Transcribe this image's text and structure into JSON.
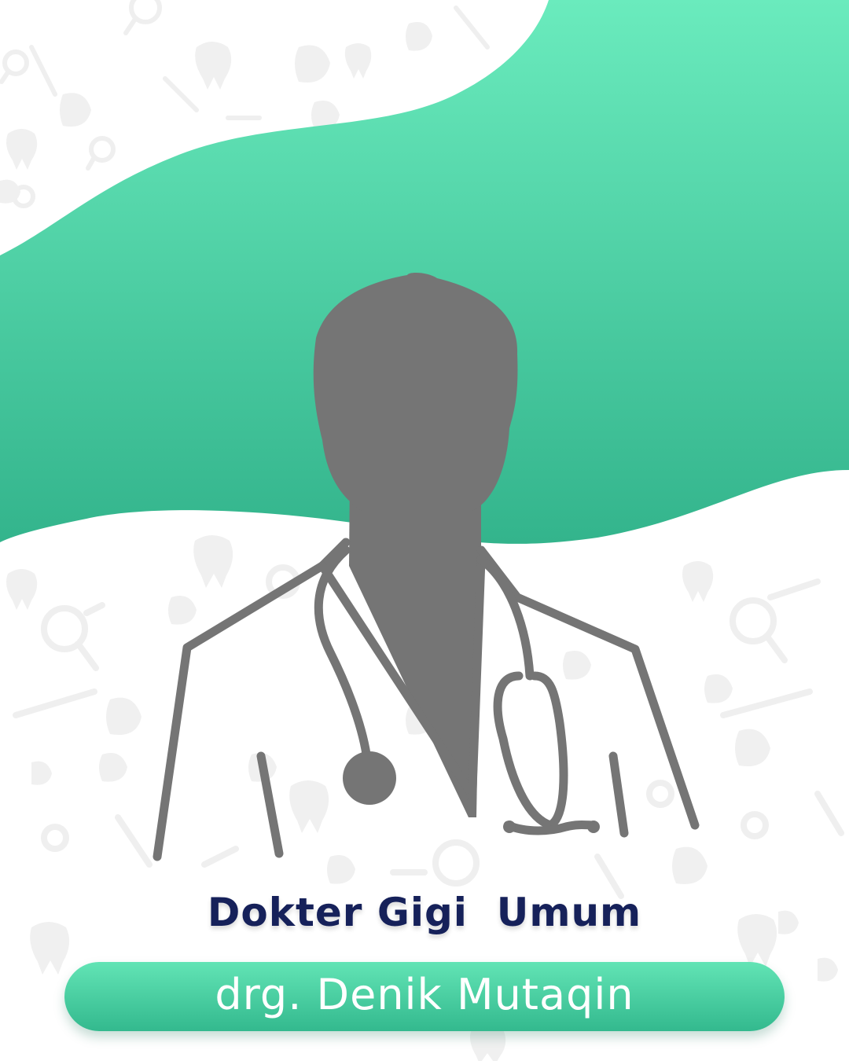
{
  "colors": {
    "accent_top": "#6aebbd",
    "accent_bottom": "#33b48c",
    "silhouette": "#757575",
    "title_text": "#16215a",
    "name_text": "#ffffff",
    "pattern": "#f0f0f0"
  },
  "icons": [
    "tooth-icon",
    "magnifier-icon",
    "toothbrush-icon",
    "leaf-icon",
    "doctor-silhouette-icon",
    "stethoscope-icon"
  ],
  "profile": {
    "specialty": "Dokter Gigi  Umum",
    "name": "drg. Denik Mutaqin"
  }
}
